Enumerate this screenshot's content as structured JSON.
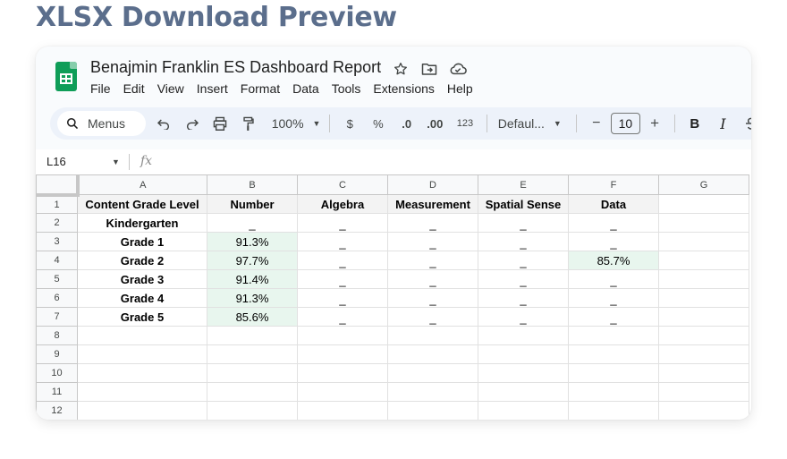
{
  "heading": "XLSX Download Preview",
  "doc": {
    "title": "Benajmin Franklin ES Dashboard Report",
    "menu": [
      "File",
      "Edit",
      "View",
      "Insert",
      "Format",
      "Data",
      "Tools",
      "Extensions",
      "Help"
    ]
  },
  "toolbar": {
    "search_label": "Menus",
    "zoom": "100%",
    "currency": "$",
    "percent": "%",
    "decrease_decimal": ".0",
    "increase_decimal": ".00",
    "number_format": "123",
    "font": "Defaul...",
    "font_size": "10",
    "minus": "−",
    "plus": "+",
    "bold": "B",
    "italic": "I"
  },
  "formula_bar": {
    "cell_ref": "L16",
    "fx": "fx"
  },
  "sheet": {
    "columns": [
      "A",
      "B",
      "C",
      "D",
      "E",
      "F",
      "G"
    ],
    "row_numbers": [
      "1",
      "2",
      "3",
      "4",
      "5",
      "6",
      "7",
      "8",
      "9",
      "10",
      "11",
      "12"
    ],
    "headers": [
      "Content Grade Level",
      "Number",
      "Algebra",
      "Measurement",
      "Spatial Sense",
      "Data"
    ],
    "rows": [
      [
        "Kindergarten",
        "_",
        "_",
        "_",
        "_",
        "_"
      ],
      [
        "Grade 1",
        "91.3%",
        "_",
        "_",
        "_",
        "_"
      ],
      [
        "Grade 2",
        "97.7%",
        "_",
        "_",
        "_",
        "85.7%"
      ],
      [
        "Grade 3",
        "91.4%",
        "_",
        "_",
        "_",
        "_"
      ],
      [
        "Grade 4",
        "91.3%",
        "_",
        "_",
        "_",
        "_"
      ],
      [
        "Grade 5",
        "85.6%",
        "_",
        "_",
        "_",
        "_"
      ]
    ],
    "highlight_color": "#e8f6ee"
  },
  "colors": {
    "heading": "#5b6e8c",
    "logo": "#0f9d58",
    "toolbar_bg": "#edf2fa"
  },
  "icons": [
    "sheets-logo-icon",
    "star-icon",
    "move-folder-icon",
    "cloud-status-icon",
    "search-icon",
    "undo-icon",
    "redo-icon",
    "print-icon",
    "paint-format-icon",
    "strikethrough-icon"
  ]
}
